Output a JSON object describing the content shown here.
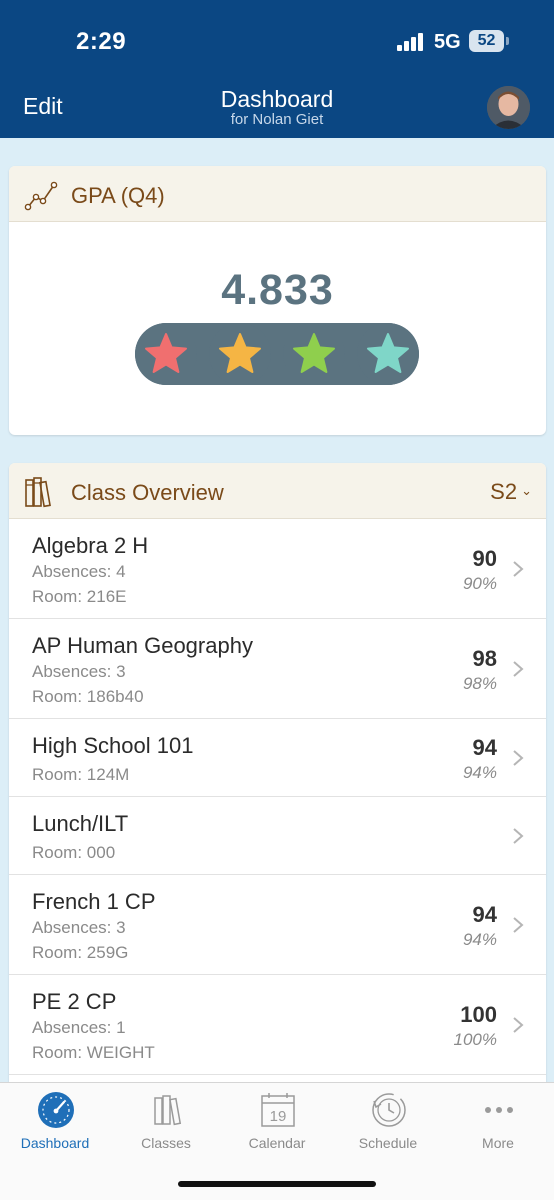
{
  "status_bar": {
    "time": "2:29",
    "network": "5G",
    "battery": "52"
  },
  "nav": {
    "edit_label": "Edit",
    "title": "Dashboard",
    "subtitle": "for Nolan Giet"
  },
  "gpa_card": {
    "title": "GPA (Q4)",
    "value": "4.833",
    "star_colors": [
      "#f06f6f",
      "#f5b544",
      "#8fcf4d",
      "#7fd6c8"
    ]
  },
  "overview_card": {
    "title": "Class Overview",
    "semester": "S2",
    "classes": [
      {
        "name": "Algebra 2 H",
        "absences": "Absences: 4",
        "room": "Room: 216E",
        "grade": "90",
        "percent": "90%"
      },
      {
        "name": "AP Human Geography",
        "absences": "Absences: 3",
        "room": "Room: 186b40",
        "grade": "98",
        "percent": "98%"
      },
      {
        "name": "High School 101",
        "absences": "",
        "room": "Room: 124M",
        "grade": "94",
        "percent": "94%"
      },
      {
        "name": "Lunch/ILT",
        "absences": "",
        "room": "Room: 000",
        "grade": "",
        "percent": ""
      },
      {
        "name": "French 1 CP",
        "absences": "Absences: 3",
        "room": "Room: 259G",
        "grade": "94",
        "percent": "94%"
      },
      {
        "name": "PE 2 CP",
        "absences": "Absences: 1",
        "room": "Room: WEIGHT",
        "grade": "100",
        "percent": "100%"
      }
    ]
  },
  "tabs": [
    {
      "label": "Dashboard",
      "icon": "dashboard-gauge-icon",
      "active": true
    },
    {
      "label": "Classes",
      "icon": "books-icon",
      "active": false
    },
    {
      "label": "Calendar",
      "icon": "calendar-icon",
      "active": false,
      "day": "19"
    },
    {
      "label": "Schedule",
      "icon": "clock-history-icon",
      "active": false
    },
    {
      "label": "More",
      "icon": "more-dots-icon",
      "active": false
    }
  ],
  "colors": {
    "header": "#0b4783",
    "accent": "#1f6fb8",
    "card_title": "#7a4a19",
    "gpa": "#5b7380"
  }
}
